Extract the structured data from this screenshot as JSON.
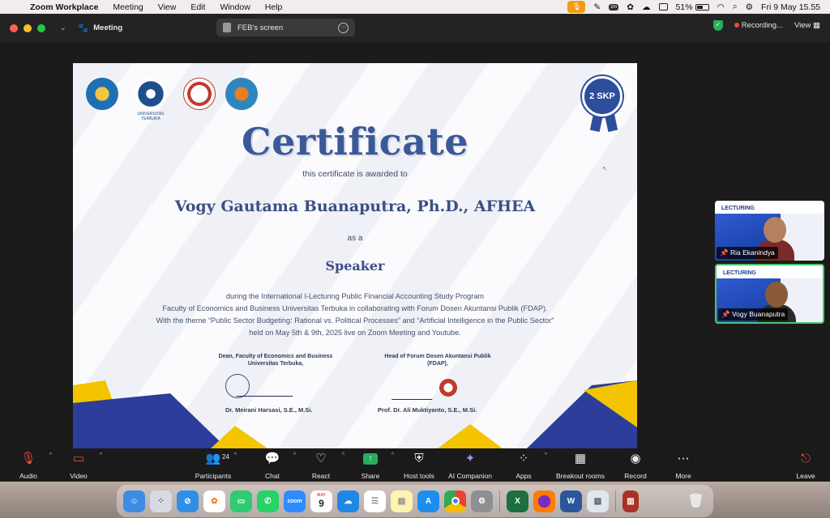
{
  "menubar": {
    "app_name": "Zoom Workplace",
    "menus": [
      "Meeting",
      "View",
      "Edit",
      "Window",
      "Help"
    ],
    "battery": "51%",
    "clock": "Fri 9 May  15.55"
  },
  "window": {
    "meeting_label": "Meeting",
    "screen_label": "FEB's screen",
    "recording": "Recording...",
    "view_label": "View"
  },
  "certificate": {
    "badge": "2 SKP",
    "logo_caption": "UNIVERSITAS TERBUKA",
    "title": "Certificate",
    "awarded": "this certificate is awarded to",
    "name": "Vogy Gautama Buanaputra, Ph.D., AFHEA",
    "as_a": "as a",
    "role": "Speaker",
    "desc_lines": [
      "during the International I-Lecturing Public Financial Accounting Study Program",
      "Faculty of Economics and Business Universitas Terbuka in collaborating with Forum Dosen Akuntansi Publik (FDAP).",
      "With the theme “Public Sector Budgeting: Rational vs. Political Processes” and “Artificial Intelligence in the Public Sector”",
      "held on May 5th & 9th, 2025 live on Zoom Meeting and Youtube."
    ],
    "sig1_title_1": "Dean, Faculty of Economics and Business",
    "sig1_title_2": "Universitas Terbuka,",
    "sig1_name": "Dr. Meirani Harsasi, S.E., M.Si.",
    "sig2_title_1": "Head of Forum Dosen Akuntansi Publik",
    "sig2_title_2": "(FDAP),",
    "sig2_name": "Prof. Dr. Ali Muktiyanto, S.E., M.Si."
  },
  "participants_tiles": [
    {
      "name": "Ria Ekanindya",
      "banner": "LECTURING"
    },
    {
      "name": "Vogy Buanaputra",
      "banner": "LECTURING"
    }
  ],
  "toolbar": {
    "audio": "Audio",
    "video": "Video",
    "participants": "Participants",
    "participant_count": "24",
    "chat": "Chat",
    "react": "React",
    "share": "Share",
    "host_tools": "Host tools",
    "ai_companion": "AI Companion",
    "apps": "Apps",
    "breakout": "Breakout rooms",
    "record": "Record",
    "more": "More",
    "leave": "Leave"
  },
  "dock": {
    "apps": [
      "finder-icon",
      "launchpad-icon",
      "safari-icon",
      "photos-icon",
      "facetime-icon",
      "whatsapp-icon",
      "zoom-icon",
      "calendar-icon",
      "onedrive-icon",
      "reminders-icon",
      "notes-icon",
      "appstore-icon",
      "chrome-icon",
      "settings-icon",
      "excel-icon",
      "firefox-icon",
      "word-icon",
      "preview-icon",
      "book-icon",
      "trash-icon"
    ],
    "zoom_label": "zoom",
    "calendar_month": "MAY",
    "calendar_day": "9",
    "word_letter": "W",
    "excel_letter": "X"
  },
  "colors": {
    "accent_blue": "#3b5998",
    "share_green": "#27ae60",
    "active_border": "#49c86b"
  }
}
